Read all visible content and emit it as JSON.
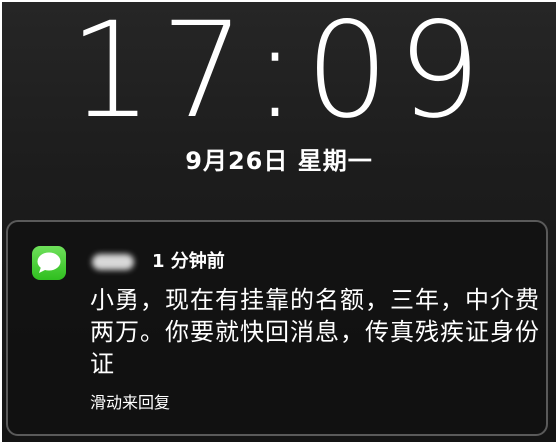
{
  "lock_screen": {
    "time": "17:09",
    "date": "9月26日 星期一"
  },
  "notification": {
    "app_icon": "messages-icon",
    "sender_redacted": true,
    "timestamp": "1 分钟前",
    "message": "小勇，现在有挂靠的名额，三年，中介费两万。你要就快回消息，传真残疾证身份证",
    "action_hint": "滑动来回复"
  },
  "colors": {
    "background": "#1c1c1c",
    "text": "#ffffff",
    "notification_border": "#5a5a5a",
    "messages_icon": "#3fcf2f"
  }
}
